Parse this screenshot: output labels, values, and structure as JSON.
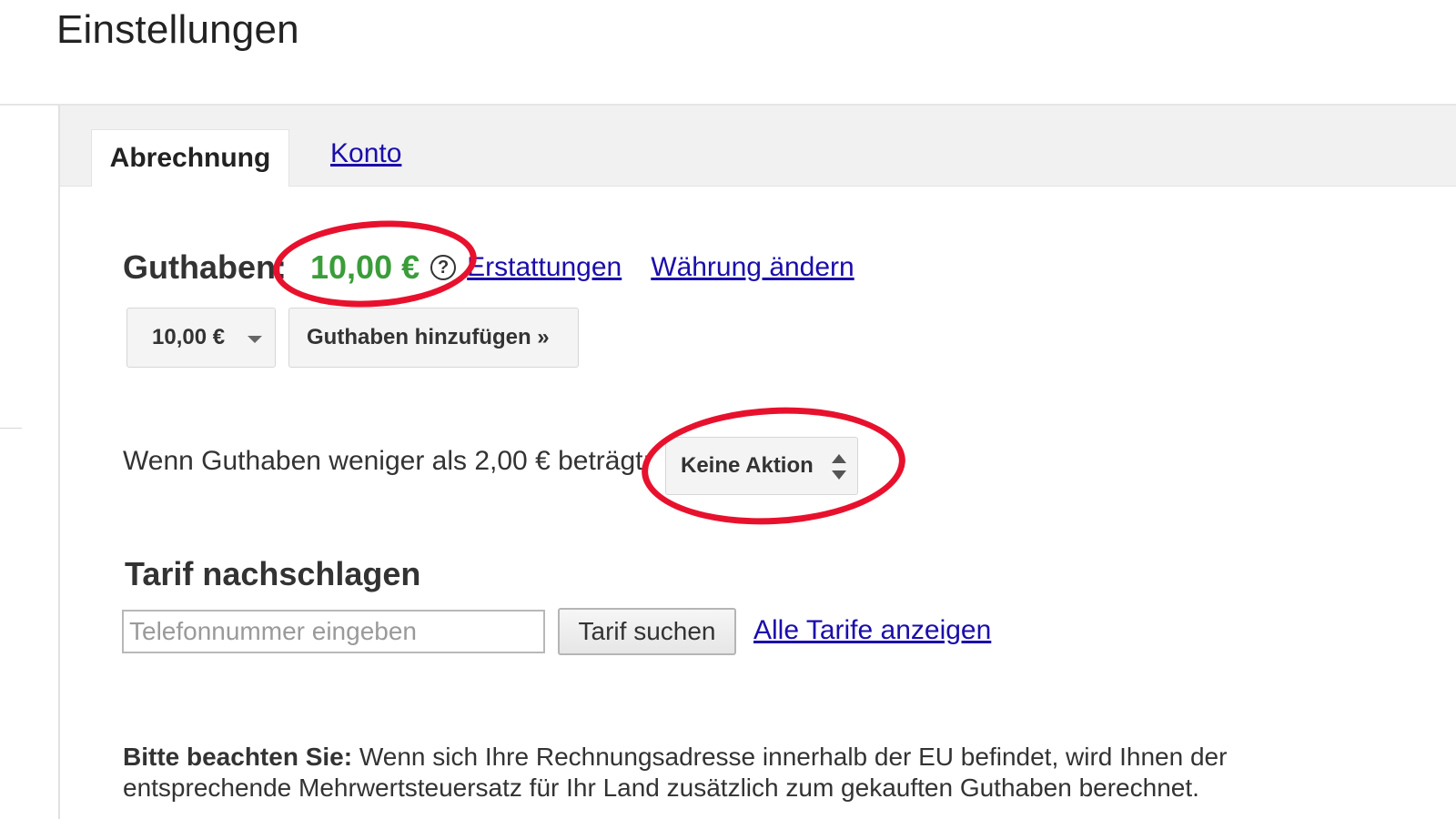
{
  "page": {
    "title": "Einstellungen"
  },
  "tabs": [
    {
      "label": "Abrechnung",
      "active": true
    },
    {
      "label": "Konto",
      "active": false
    }
  ],
  "balance": {
    "label": "Guthaben",
    "colon": ":",
    "value": "10,00 €",
    "help_icon": "question-circle-icon",
    "help_glyph": "?",
    "links": {
      "refunds": "Erstattungen",
      "change_currency": "Währung ändern"
    }
  },
  "add_credit": {
    "amount_selected": "10,00 €",
    "button_label": "Guthaben hinzufügen »"
  },
  "auto_action": {
    "text": "Wenn Guthaben weniger als 2,00 € beträgt:",
    "selected": "Keine Aktion"
  },
  "rate_lookup": {
    "heading": "Tarif nachschlagen",
    "input_placeholder": "Telefonnummer eingeben",
    "search_button": "Tarif suchen",
    "all_rates_link": "Alle Tarife anzeigen"
  },
  "notice": {
    "bold": "Bitte beachten Sie:",
    "text": " Wenn sich Ihre Rechnungsadresse innerhalb der EU befindet, wird Ihnen der entsprechende Mehrwertsteuersatz für Ihr Land zusätzlich zum gekauften Guthaben berechnet."
  },
  "colors": {
    "accent_link": "#1a0dab",
    "balance_green": "#3a9d3a",
    "annotation_red": "#e8112d"
  }
}
